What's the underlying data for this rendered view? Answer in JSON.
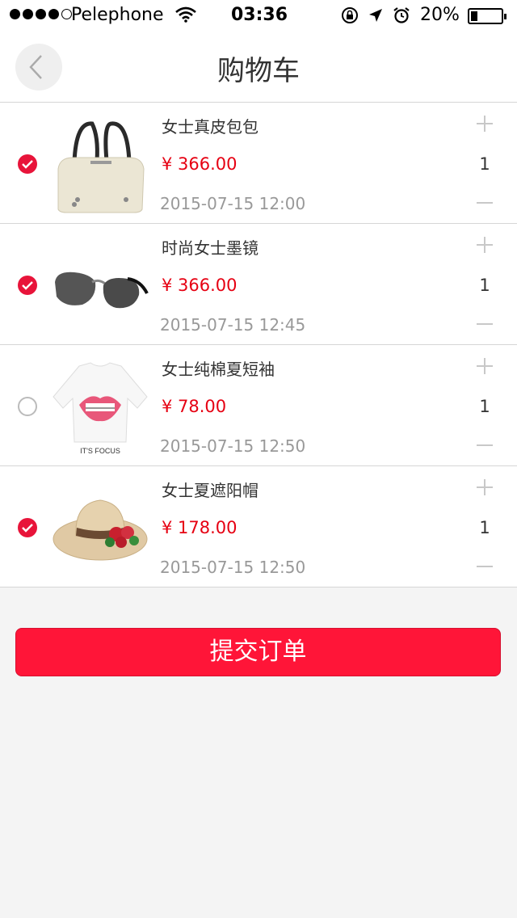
{
  "status_bar": {
    "carrier": "Pelephone",
    "time": "03:36",
    "battery": "20%",
    "signal_bars": 4
  },
  "header": {
    "title": "购物车",
    "back_icon": "chevron-left-icon"
  },
  "items": [
    {
      "name": "女士真皮包包",
      "price": "¥ 366.00",
      "date": "2015-07-15 12:00",
      "quantity": "1",
      "selected": true,
      "image": "handbag"
    },
    {
      "name": "时尚女士墨镜",
      "price": "¥ 366.00",
      "date": "2015-07-15 12:45",
      "quantity": "1",
      "selected": true,
      "image": "sunglasses"
    },
    {
      "name": "女士纯棉夏短袖",
      "price": "¥ 78.00",
      "date": "2015-07-15 12:50",
      "quantity": "1",
      "selected": false,
      "image": "tshirt",
      "image_caption": "IT'S FOCUS"
    },
    {
      "name": "女士夏遮阳帽",
      "price": "¥ 178.00",
      "date": "2015-07-15 12:50",
      "quantity": "1",
      "selected": true,
      "image": "sun-hat"
    }
  ],
  "footer": {
    "submit_label": "提交订单"
  },
  "colors": {
    "accent": "#ff1538",
    "price": "#e60012",
    "checked": "#e8143a",
    "background": "#f4f4f4"
  }
}
